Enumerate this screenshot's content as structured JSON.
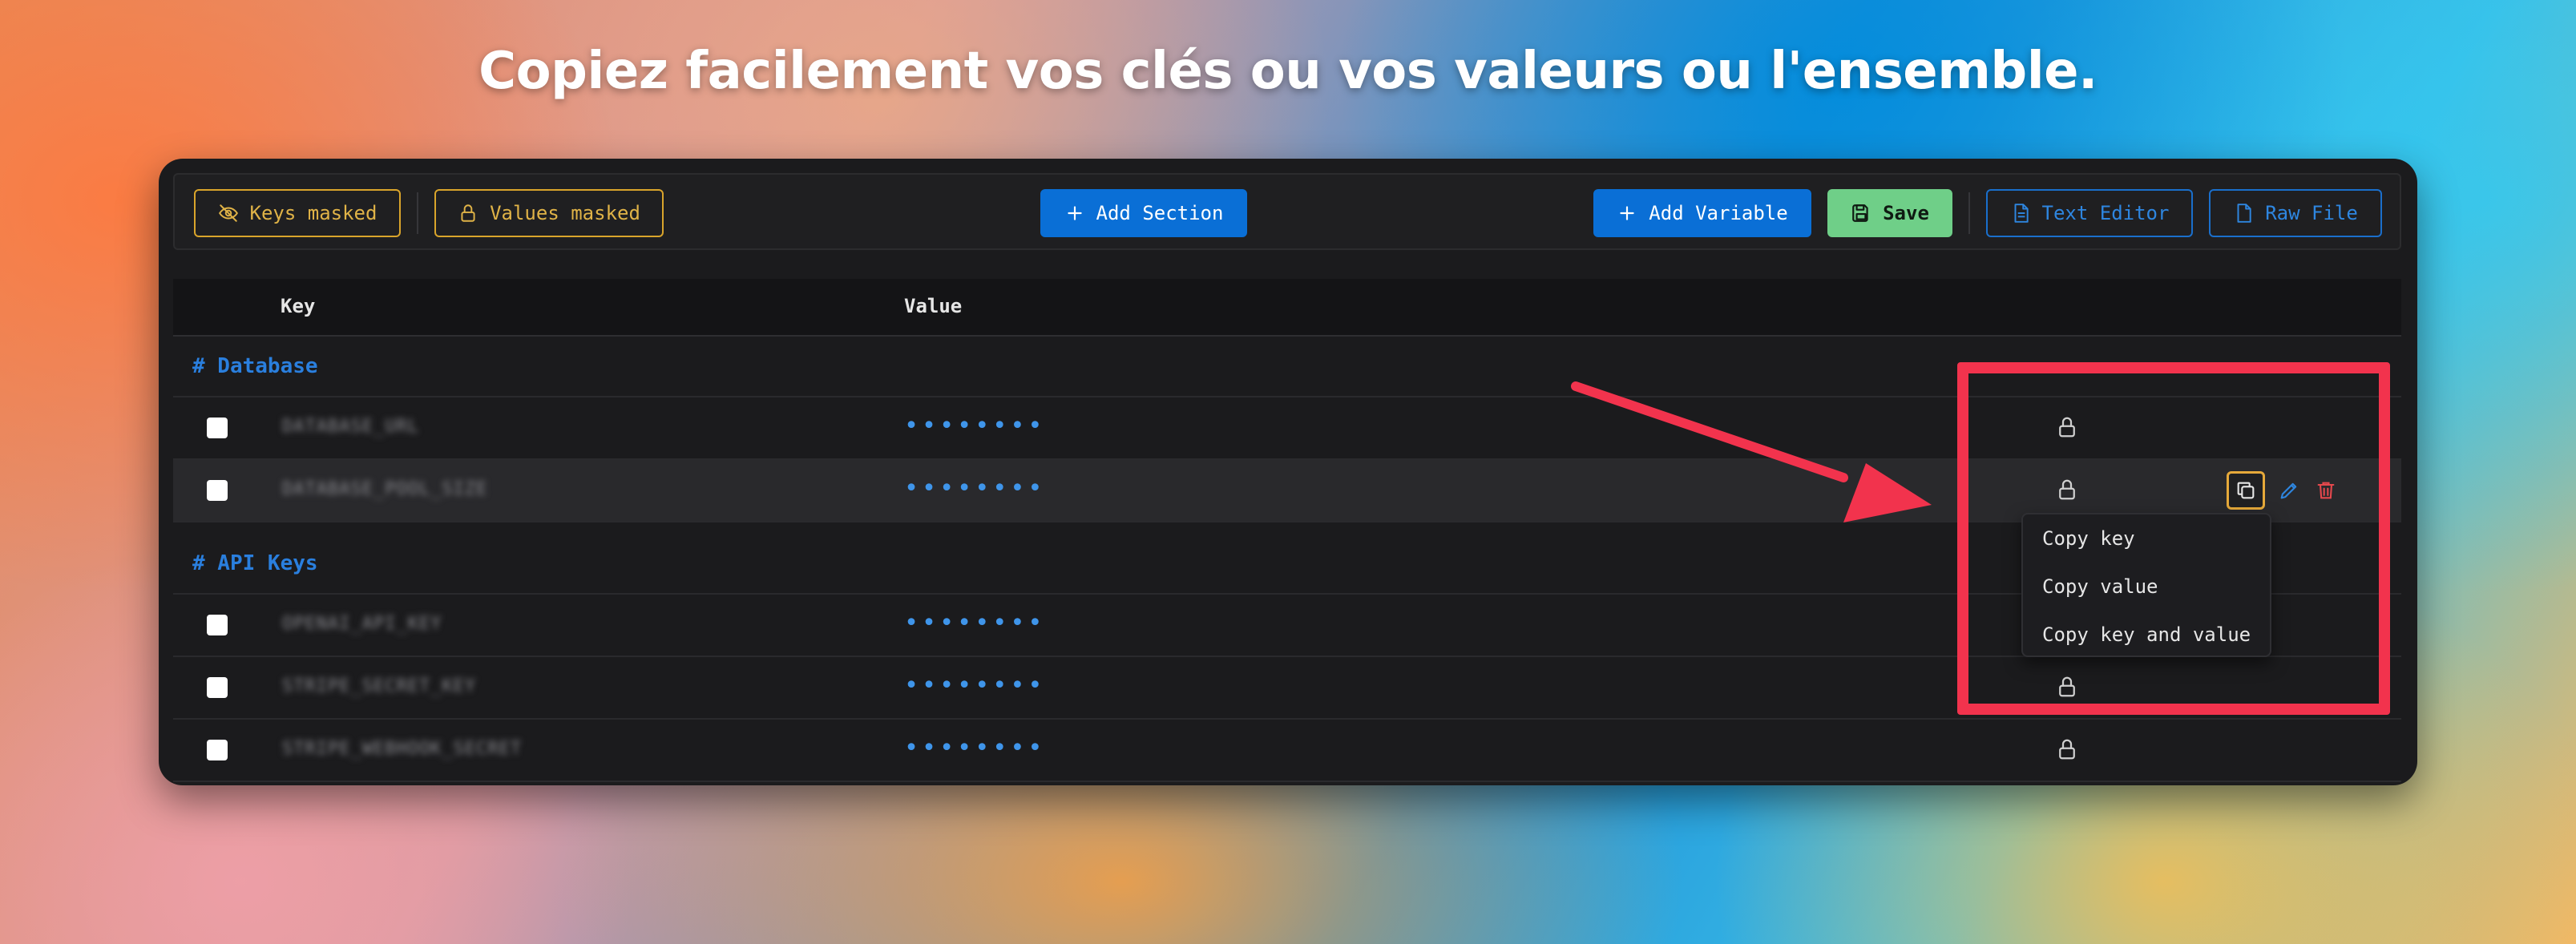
{
  "headline": "Copiez facilement vos clés ou vos valeurs ou l'ensemble.",
  "toolbar": {
    "keys_masked": "Keys masked",
    "values_masked": "Values masked",
    "add_section": "Add Section",
    "add_variable": "Add Variable",
    "save": "Save",
    "text_editor": "Text Editor",
    "raw_file": "Raw File"
  },
  "table": {
    "col_key": "Key",
    "col_value": "Value",
    "sections": [
      {
        "label": "# Database",
        "rows": [
          {
            "key": "DATABASE_URL",
            "value": "••••••••"
          },
          {
            "key": "DATABASE_POOL_SIZE",
            "value": "••••••••"
          }
        ]
      },
      {
        "label": "# API Keys",
        "rows": [
          {
            "key": "OPENAI_API_KEY",
            "value": "••••••••"
          },
          {
            "key": "STRIPE_SECRET_KEY",
            "value": "••••••••"
          },
          {
            "key": "STRIPE_WEBHOOK_SECRET",
            "value": "••••••••"
          }
        ]
      }
    ]
  },
  "copy_menu": {
    "copy_key": "Copy key",
    "copy_value": "Copy value",
    "copy_key_and_value": "Copy key and value"
  },
  "colors": {
    "accent_blue": "#0a6fd6",
    "save_green": "#6fcf88",
    "mask_yellow": "#d9a42b",
    "highlight_red": "#f2334d",
    "delete_red": "#e5484d"
  }
}
